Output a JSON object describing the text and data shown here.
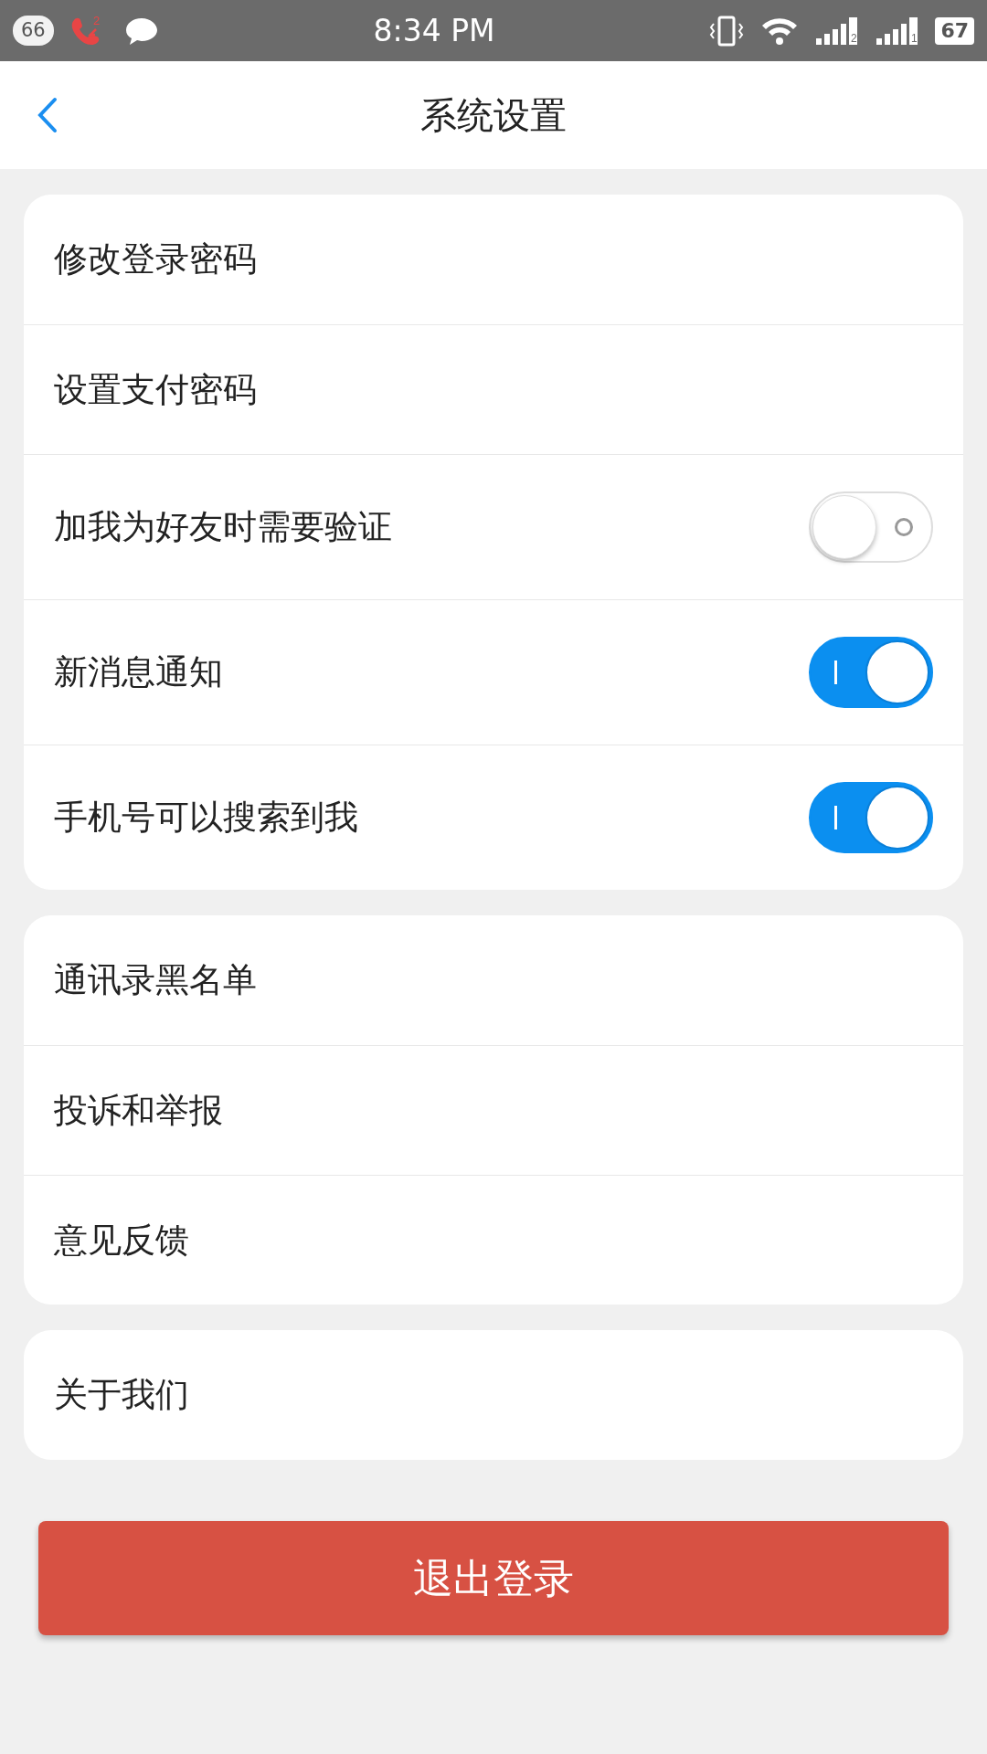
{
  "status_bar": {
    "notification_count": "66",
    "missed_calls": "2",
    "time": "8:34 PM",
    "signals": [
      {
        "label": "2"
      },
      {
        "label": "1"
      }
    ],
    "battery": "67"
  },
  "header": {
    "title": "系统设置"
  },
  "groups": [
    {
      "items": [
        {
          "label": "修改登录密码",
          "kind": "link"
        },
        {
          "label": "设置支付密码",
          "kind": "link"
        },
        {
          "label": "加我为好友时需要验证",
          "kind": "toggle",
          "on": false
        },
        {
          "label": "新消息通知",
          "kind": "toggle",
          "on": true
        },
        {
          "label": "手机号可以搜索到我",
          "kind": "toggle",
          "on": true
        }
      ]
    },
    {
      "items": [
        {
          "label": "通讯录黑名单",
          "kind": "link"
        },
        {
          "label": "投诉和举报",
          "kind": "link"
        },
        {
          "label": "意见反馈",
          "kind": "link"
        }
      ]
    },
    {
      "items": [
        {
          "label": "关于我们",
          "kind": "link"
        }
      ]
    }
  ],
  "logout_button": "退出登录"
}
